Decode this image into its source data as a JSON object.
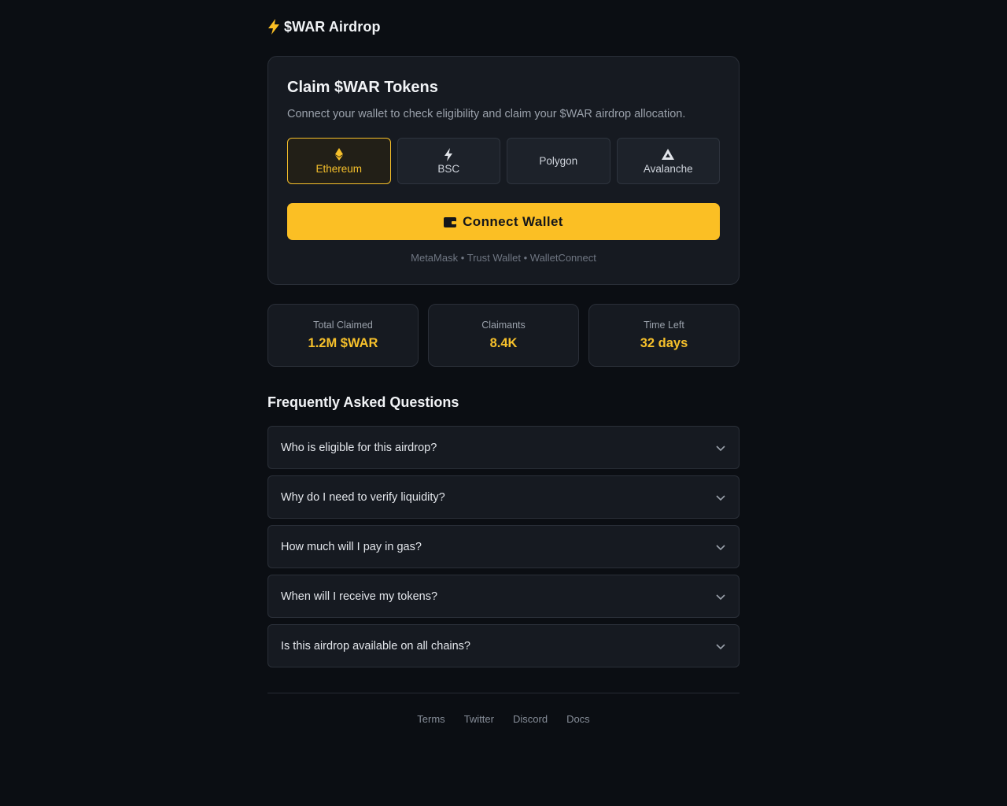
{
  "brand": {
    "name": "$WAR Airdrop",
    "icon": "lightning-bolt-icon",
    "accent": "#fbbf24"
  },
  "claim": {
    "title": "Claim $WAR Tokens",
    "subtitle": "Connect your wallet to check eligibility and claim your $WAR airdrop allocation.",
    "chains": [
      {
        "label": "Ethereum",
        "icon": "ethereum-icon",
        "selected": true
      },
      {
        "label": "BSC",
        "icon": "lightning-bolt-icon",
        "selected": false
      },
      {
        "label": "Polygon",
        "icon": "",
        "selected": false
      },
      {
        "label": "Avalanche",
        "icon": "avalanche-icon",
        "selected": false
      }
    ],
    "connect_label": "Connect Wallet",
    "connect_icon": "wallet-icon",
    "wallets_text": "MetaMask • Trust Wallet • WalletConnect"
  },
  "stats": [
    {
      "label": "Total Claimed",
      "value": "1.2M $WAR"
    },
    {
      "label": "Claimants",
      "value": "8.4K"
    },
    {
      "label": "Time Left",
      "value": "32 days"
    }
  ],
  "faq": {
    "title": "Frequently Asked Questions",
    "items": [
      {
        "question": "Who is eligible for this airdrop?"
      },
      {
        "question": "Why do I need to verify liquidity?"
      },
      {
        "question": "How much will I pay in gas?"
      },
      {
        "question": "When will I receive my tokens?"
      },
      {
        "question": "Is this airdrop available on all chains?"
      }
    ]
  },
  "footer": {
    "links": [
      "Terms",
      "Twitter",
      "Discord",
      "Docs"
    ]
  }
}
